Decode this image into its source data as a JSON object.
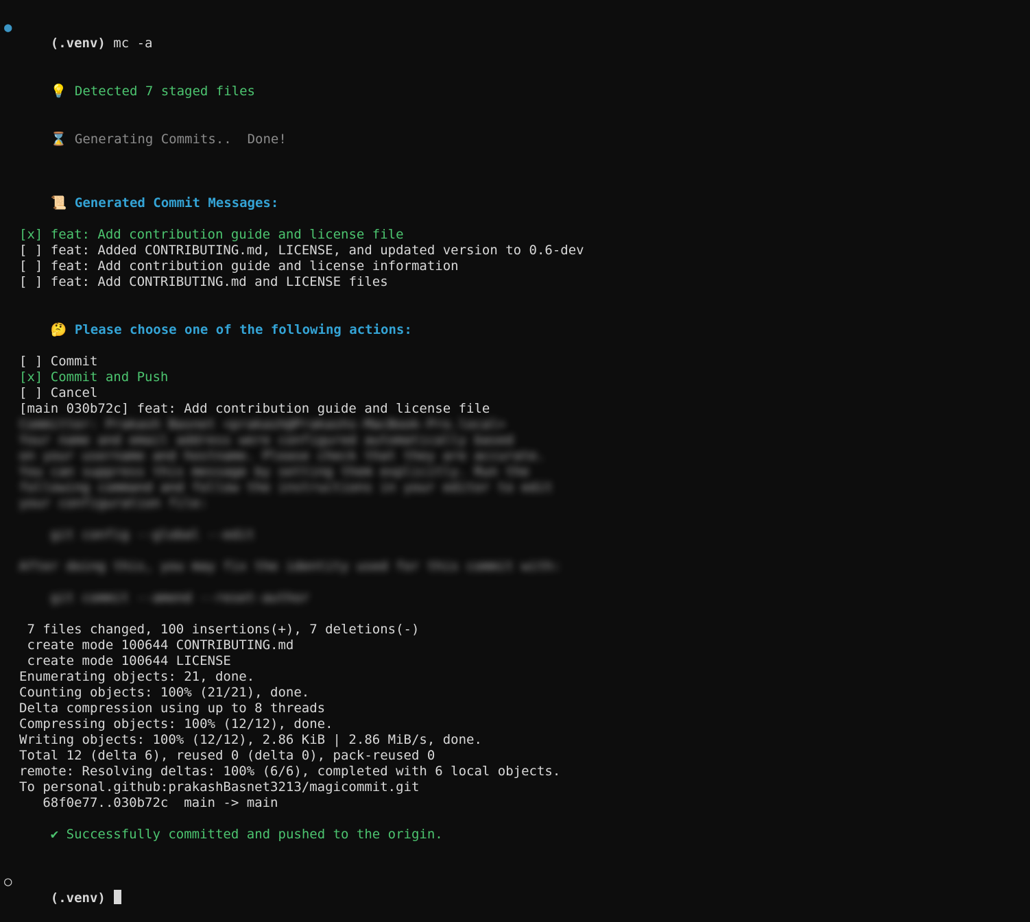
{
  "prompt1": {
    "bullet": "●",
    "venv": "(.venv) ",
    "cmd": "mc -a"
  },
  "detect": {
    "icon": "💡",
    "msg": "Detected 7 staged files"
  },
  "gen": {
    "icon": "⌛",
    "prefix": "Generating Commits..  ",
    "done": "Done!"
  },
  "commitsHeader": {
    "icon": "📜",
    "text": "Generated Commit Messages:"
  },
  "commits": [
    {
      "mark": "[x] ",
      "msg": "feat: Add contribution guide and license file",
      "selected": true
    },
    {
      "mark": "[ ] ",
      "msg": "feat: Added CONTRIBUTING.md, LICENSE, and updated version to 0.6-dev",
      "selected": false
    },
    {
      "mark": "[ ] ",
      "msg": "feat: Add contribution guide and license information",
      "selected": false
    },
    {
      "mark": "[ ] ",
      "msg": "feat: Add CONTRIBUTING.md and LICENSE files",
      "selected": false
    }
  ],
  "actionsHeader": {
    "icon": "🤔",
    "text": "Please choose one of the following actions:"
  },
  "actions": [
    {
      "mark": "[ ] ",
      "msg": "Commit",
      "selected": false
    },
    {
      "mark": "[x] ",
      "msg": "Commit and Push",
      "selected": true
    },
    {
      "mark": "[ ] ",
      "msg": "Cancel",
      "selected": false
    }
  ],
  "commitResult": "[main 030b72c] feat: Add contribution guide and license file",
  "blurred": [
    "Committer: Prakash Basnet <prakash@Prakashs-MacBook-Pro.local>",
    "Your name and email address were configured automatically based",
    "on your username and hostname. Please check that they are accurate.",
    "You can suppress this message by setting them explicitly. Run the",
    "following command and follow the instructions in your editor to edit",
    "your configuration file:",
    "",
    "    git config --global --edit",
    "",
    "After doing this, you may fix the identity used for this commit with:",
    "",
    "    git commit --amend --reset-author",
    ""
  ],
  "output": [
    " 7 files changed, 100 insertions(+), 7 deletions(-)",
    " create mode 100644 CONTRIBUTING.md",
    " create mode 100644 LICENSE",
    "Enumerating objects: 21, done.",
    "Counting objects: 100% (21/21), done.",
    "Delta compression using up to 8 threads",
    "Compressing objects: 100% (12/12), done.",
    "Writing objects: 100% (12/12), 2.86 KiB | 2.86 MiB/s, done.",
    "Total 12 (delta 6), reused 0 (delta 0), pack-reused 0",
    "remote: Resolving deltas: 100% (6/6), completed with 6 local objects.",
    "To personal.github:prakashBasnet3213/magicommit.git",
    "   68f0e77..030b72c  main -> main"
  ],
  "success": {
    "icon": "✔ ",
    "msg": "Successfully committed and pushed to the origin."
  },
  "prompt2": {
    "bullet": "○",
    "venv": "(.venv) "
  }
}
